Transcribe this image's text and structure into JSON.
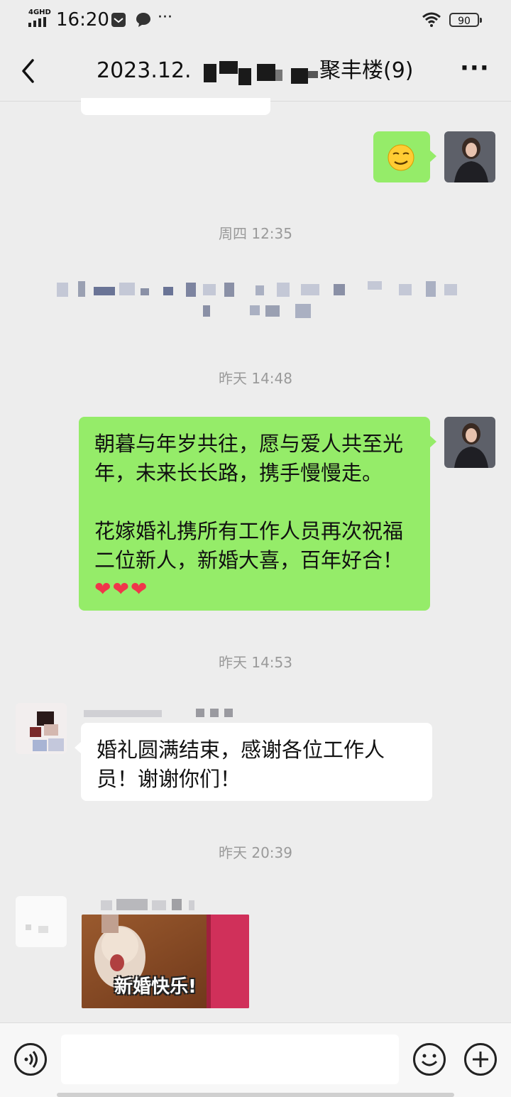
{
  "status_bar": {
    "network": "4GHD",
    "time": "16:20",
    "battery": "90"
  },
  "header": {
    "title_prefix": "2023.12.",
    "title_suffix": "聚丰楼(9)",
    "back_icon": "chevron-left-icon",
    "more_icon": "more-dots-icon"
  },
  "chat": {
    "timestamps": [
      "周四 12:35",
      "昨天 14:48",
      "昨天 14:53",
      "昨天 20:39"
    ],
    "msg_wedding_blessing": {
      "para1": "朝暮与年岁共往，愿与爱人共至光年，未来长长路，携手慢慢走。",
      "para2": "花嫁婚礼携所有工作人员再次祝福二位新人，新婚大喜，百年好合！",
      "hearts": "❤❤❤"
    },
    "msg_thanks": "婚礼圆满结束，感谢各位工作人员！谢谢你们！",
    "sticker_text": "新婚快乐!"
  },
  "input_bar": {
    "voice_icon": "voice-icon",
    "emoji_icon": "emoji-icon",
    "plus_icon": "plus-icon"
  },
  "colors": {
    "background": "#ededed",
    "bubble_self": "#95ec69",
    "bubble_other": "#ffffff"
  }
}
